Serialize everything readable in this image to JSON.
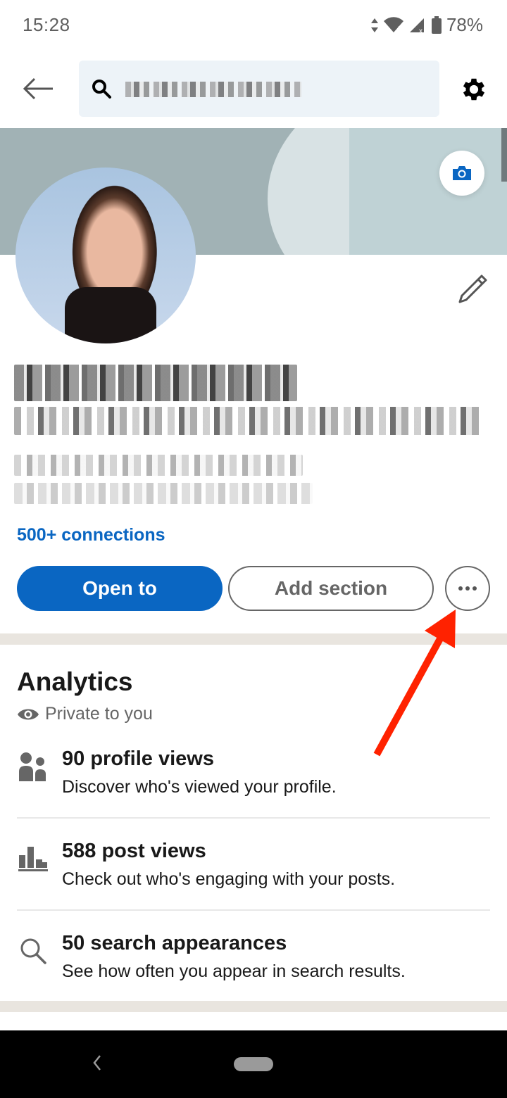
{
  "status_bar": {
    "time": "15:28",
    "battery": "78%",
    "icons": [
      "data-arrows-icon",
      "wifi-icon",
      "signal-icon",
      "battery-icon"
    ]
  },
  "top_bar": {
    "back_icon": "arrow-left-icon",
    "search": {
      "icon": "search-icon",
      "value": "[redacted]"
    },
    "settings_icon": "gear-icon"
  },
  "profile": {
    "banner_action_icon": "camera-icon",
    "avatar": "profile-photo (pixelated)",
    "edit_icon": "pencil-icon",
    "name": "[redacted]",
    "headline": "[redacted]",
    "location": "[redacted]",
    "company": "[redacted]",
    "connections": "500+ connections",
    "actions": {
      "primary": "Open to",
      "secondary": "Add section",
      "more_icon": "more-horizontal-icon"
    }
  },
  "analytics": {
    "title": "Analytics",
    "privacy_icon": "eye-icon",
    "privacy_label": "Private to you",
    "metrics": [
      {
        "icon": "people-icon",
        "title": "90 profile views",
        "description": "Discover who's viewed your profile."
      },
      {
        "icon": "bar-chart-icon",
        "title": "588 post views",
        "description": "Check out who's engaging with your posts."
      },
      {
        "icon": "search-icon",
        "title": "50 search appearances",
        "description": "See how often you appear in search results."
      }
    ]
  },
  "annotation": {
    "type": "red-arrow",
    "points_to": "more-options-button",
    "color": "#ff2200"
  },
  "nav_bar": {
    "back_icon": "nav-back-icon",
    "home_icon": "nav-home-pill"
  },
  "colors": {
    "brand_blue": "#0a66c2",
    "section_divider": "#e9e5df",
    "search_bg": "#edf3f8"
  }
}
